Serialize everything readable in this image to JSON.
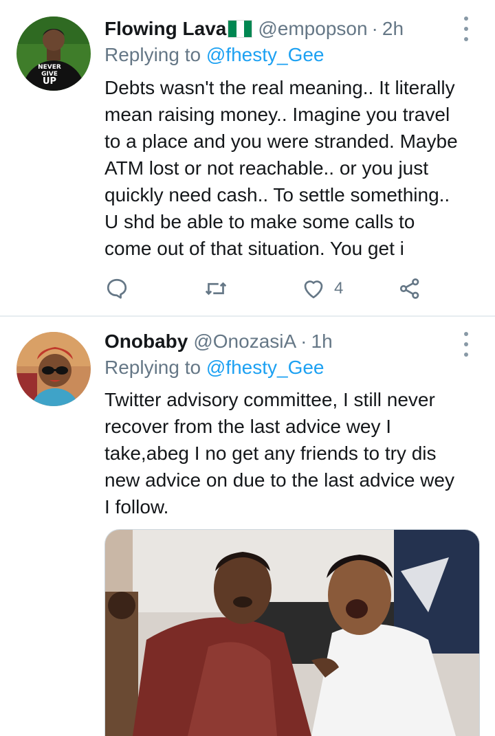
{
  "tweets": [
    {
      "name": "Flowing Lava",
      "handle": "@empopson",
      "dot": "·",
      "time": "2h",
      "replying_prefix": "Replying to",
      "replying_to": "@fhesty_Gee",
      "avatar_text": [
        "NEVER",
        "GIVE",
        "UP"
      ],
      "text_lines": [
        "Debts wasn't the real meaning.. It literally",
        "mean raising money.. Imagine you travel",
        "to a place and you were stranded. Maybe",
        "ATM lost or not reachable.. or you just",
        "quickly need cash.. To settle something..",
        "U shd be able to make some calls to",
        "come out of that situation. You get i"
      ],
      "like_count": "4",
      "icons": [
        "reply-icon",
        "retweet-icon",
        "like-icon",
        "share-icon"
      ]
    },
    {
      "name": "Onobaby",
      "handle": "@OnozasiA",
      "dot": "·",
      "time": "1h",
      "replying_prefix": "Replying to",
      "replying_to": "@fhesty_Gee",
      "text_lines": [
        "Twitter advisory committee, I still never",
        "recover from the last advice wey I",
        "take,abeg I no get any friends to try dis",
        "new advice on due to the last advice wey",
        "I follow."
      ]
    }
  ],
  "colors": {
    "link": "#1da1f2",
    "secondary": "#657786",
    "flag_green": "#008751",
    "flag_white": "#ffffff"
  }
}
